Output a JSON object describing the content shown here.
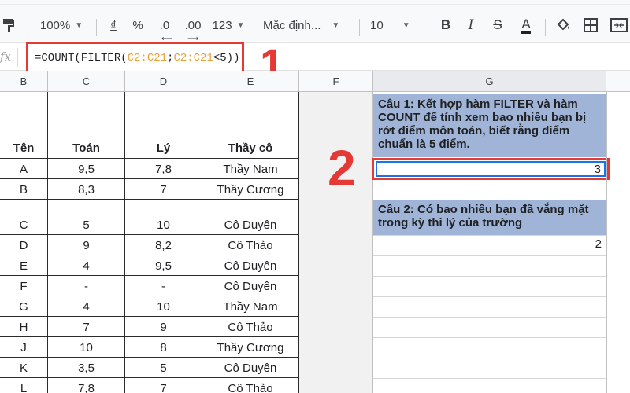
{
  "toolbar": {
    "zoom": "100%",
    "currency": "₫",
    "percent": "%",
    "decrease_decimal": ".0",
    "increase_decimal": ".00",
    "number_format": "123",
    "font_name": "Mặc định...",
    "font_size": "10",
    "bold": "B",
    "italic": "I",
    "strike": "S",
    "text_color": "A"
  },
  "formula_bar": {
    "fx_label": "fx",
    "formula_parts": [
      "=COUNT(FILTER(",
      "C2:C21",
      ";",
      "C2:C21",
      "<5))"
    ]
  },
  "annotations": {
    "label_1": "1",
    "label_2": "2"
  },
  "columns": [
    "B",
    "C",
    "D",
    "E",
    "F",
    "G"
  ],
  "table": {
    "headers": [
      "Tên",
      "Toán",
      "Lý",
      "Thầy cô"
    ],
    "rows": [
      [
        "A",
        "9,5",
        "7,8",
        "Thầy Nam"
      ],
      [
        "B",
        "8,3",
        "7",
        "Thầy Cương"
      ],
      [
        "C",
        "5",
        "10",
        "Cô Duyên"
      ],
      [
        "D",
        "9",
        "8,2",
        "Cô Thảo"
      ],
      [
        "E",
        "4",
        "9,5",
        "Cô Duyên"
      ],
      [
        "F",
        "-",
        "-",
        "Cô Duyên"
      ],
      [
        "G",
        "4",
        "10",
        "Thầy Nam"
      ],
      [
        "H",
        "7",
        "9",
        "Cô Thảo"
      ],
      [
        "J",
        "10",
        "8",
        "Thầy Cương"
      ],
      [
        "K",
        "3,5",
        "5",
        "Cô Duyên"
      ],
      [
        "L",
        "7,8",
        "7",
        "Cô Thảo"
      ]
    ]
  },
  "questions": {
    "q1": "Câu 1: Kết hợp hàm FILTER và hàm COUNT để tính xem bao nhiêu bạn bị rớt điểm môn toán, biết rằng điểm chuẩn là 5 điểm.",
    "a1": "3",
    "q2": "Câu 2: Có bao nhiêu bạn đã vắng mặt trong kỳ thi lý của trường",
    "a2": "2"
  },
  "colors": {
    "accent_red": "#e53935",
    "question_fill": "#9fb4d6",
    "selection_blue": "#1a73e8",
    "formula_ref": "#e8a13a"
  }
}
